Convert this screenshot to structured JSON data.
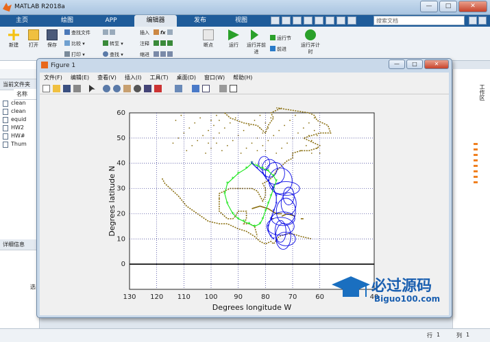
{
  "app": {
    "title": "MATLAB R2018a",
    "window_controls": [
      "—",
      "□",
      "✕"
    ]
  },
  "ribbon_tabs": [
    {
      "label": "主页",
      "active": false
    },
    {
      "label": "绘图",
      "active": false
    },
    {
      "label": "APP",
      "active": false
    },
    {
      "label": "编辑器",
      "active": true
    },
    {
      "label": "发布",
      "active": false
    },
    {
      "label": "视图",
      "active": false
    }
  ],
  "search_placeholder": "搜索文档",
  "ribbon": {
    "new": "新建",
    "open": "打开",
    "save": "保存",
    "find_files": "查找文件",
    "compare": "比较",
    "print": "打印",
    "goto": "转至",
    "find": "查找",
    "insert": "插入",
    "comment": "注释",
    "indent": "缩进",
    "breakpoints": "断点",
    "run": "运行",
    "run_advance": "运行并前进",
    "run_section": "运行节",
    "advance": "前进",
    "run_time": "运行并计时"
  },
  "left_panel": {
    "header": "当前文件夹",
    "column": "名称",
    "files": [
      "clean",
      "clean",
      "equid",
      "HW2",
      "HW#",
      "Thum"
    ],
    "details_header": "详细信息",
    "select_text": "选"
  },
  "right_panel": {
    "label": "工作区"
  },
  "status": {
    "row_label": "行",
    "row_value": "1",
    "col_label": "列",
    "col_value": "1"
  },
  "figure": {
    "title": "Figure 1",
    "controls": [
      "—",
      "□",
      "✕"
    ],
    "menu": [
      "文件(F)",
      "编辑(E)",
      "查看(V)",
      "插入(I)",
      "工具(T)",
      "桌面(D)",
      "窗口(W)",
      "帮助(H)"
    ]
  },
  "colors": {
    "coast": "#8a6f10",
    "track_green": "#19e619",
    "track_blue": "#0a0ae6",
    "ribbon_blue": "#1f5c9a",
    "grid": "#2b2b8a"
  },
  "watermark": {
    "big": "必过源码",
    "small": "Biguo100.com"
  },
  "chart_data": {
    "type": "line",
    "title": "",
    "xlabel": "Degrees longitude W",
    "ylabel": "Degrees latitude N",
    "xlim": [
      130,
      40
    ],
    "ylim": [
      -10,
      60
    ],
    "x_reversed": true,
    "xticks": [
      130,
      120,
      110,
      100,
      90,
      80,
      70,
      60,
      40
    ],
    "yticks": [
      60,
      50,
      40,
      30,
      20,
      10,
      0
    ],
    "grid": true,
    "equator_line": 0,
    "series": [
      {
        "color": "green",
        "marker": "*",
        "x": [
          85,
          87,
          90,
          92,
          94,
          95,
          94,
          92,
          90,
          88,
          86,
          84,
          82,
          81,
          80,
          79,
          78,
          77,
          76,
          77,
          79,
          81,
          83,
          85
        ],
        "y": [
          40,
          38,
          36,
          34,
          32,
          28,
          24,
          20,
          18,
          17,
          16,
          15,
          16,
          18,
          21,
          24,
          27,
          30,
          33,
          35,
          37,
          38,
          39,
          40
        ]
      },
      {
        "color": "blue",
        "marker": "*",
        "x": [
          85,
          83,
          81,
          79,
          77,
          76,
          76,
          77,
          78,
          79,
          79,
          78,
          77
        ],
        "y": [
          40,
          38,
          36,
          33,
          30,
          27,
          24,
          21,
          18,
          15,
          13,
          11,
          10
        ]
      }
    ]
  }
}
